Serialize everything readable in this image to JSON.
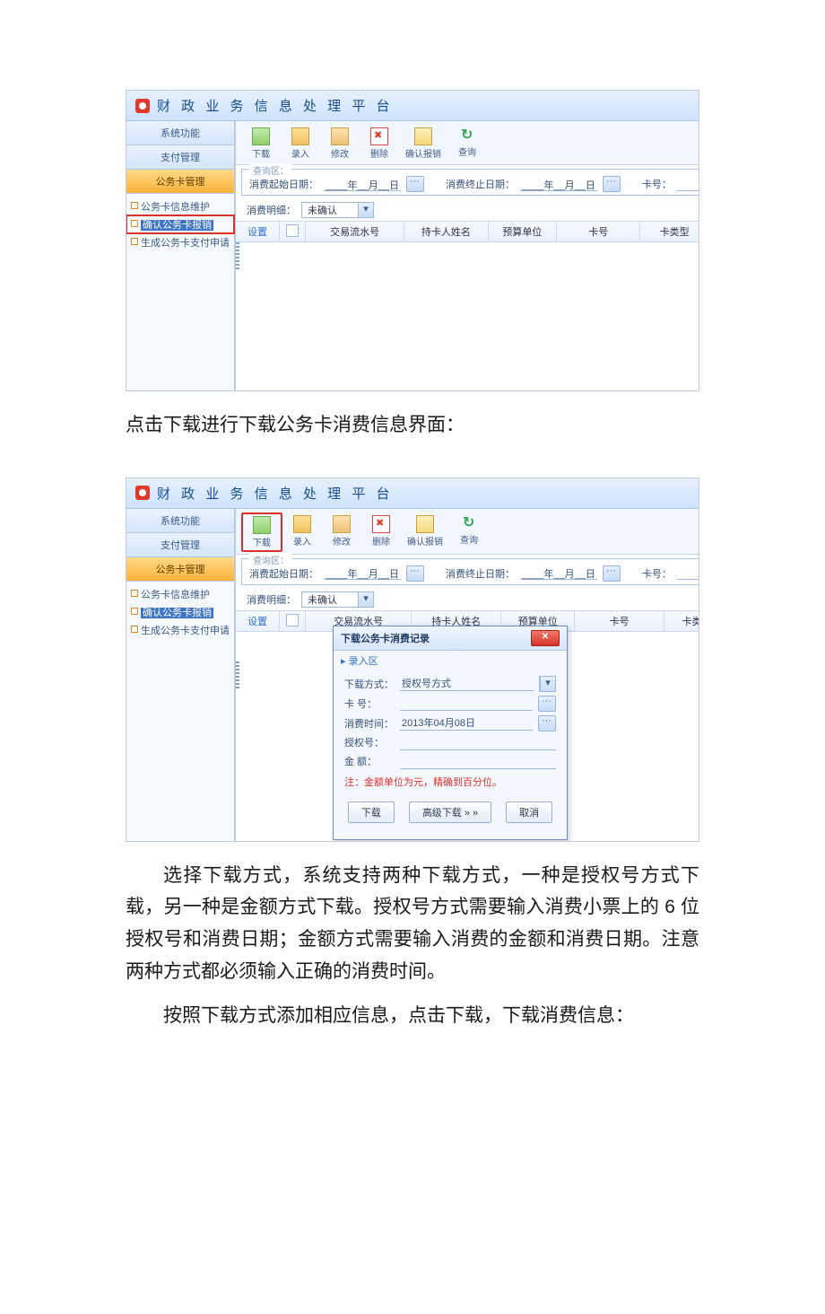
{
  "app": {
    "title": "财 政 业 务 信 息 处 理 平 台"
  },
  "sidebar": {
    "head1": "系统功能",
    "head2": "支付管理",
    "head3": "公务卡管理",
    "items": [
      {
        "label": "公务卡信息维护"
      },
      {
        "label": "确认公务卡报销"
      },
      {
        "label": "生成公务卡支付申请"
      }
    ]
  },
  "toolbar": {
    "download": "下载",
    "import": "录入",
    "edit": "修改",
    "delete": "删除",
    "confirm": "确认报销",
    "query": "查询"
  },
  "query": {
    "legend": "查询区：",
    "start_label": "消费起始日期：",
    "date_placeholder": "____年__月__日",
    "end_label": "消费终止日期：",
    "cardno_label": "卡号：",
    "detail_label": "消费明细：",
    "detail_value": "未确认"
  },
  "grid": {
    "setting": "设置",
    "cols": [
      "交易流水号",
      "持卡人姓名",
      "预算单位",
      "卡号",
      "卡类型"
    ]
  },
  "grid2_extra": "卡类别",
  "dialog": {
    "title": "下载公务卡消费记录",
    "subtitle": "▸ 录入区",
    "mode_label": "下载方式：",
    "mode_value": "授权号方式",
    "card_label": "卡 号：",
    "time_label": "消费时间：",
    "time_value": "2013年04月08日",
    "auth_label": "授权号：",
    "amount_label": "金 额：",
    "note": "注：金额单位为元，精确到百分位。",
    "btn_download": "下载",
    "btn_adv": "高级下载 » »",
    "btn_cancel": "取消"
  },
  "text": {
    "p1": "点击下载进行下载公务卡消费信息界面：",
    "p2": "选择下载方式，系统支持两种下载方式，一种是授权号方式下载，另一种是金额方式下载。授权号方式需要输入消费小票上的 6 位授权号和消费日期；金额方式需要输入消费的金额和消费日期。注意两种方式都必须输入正确的消费时间。",
    "p3": "按照下载方式添加相应信息，点击下载，下载消费信息："
  }
}
